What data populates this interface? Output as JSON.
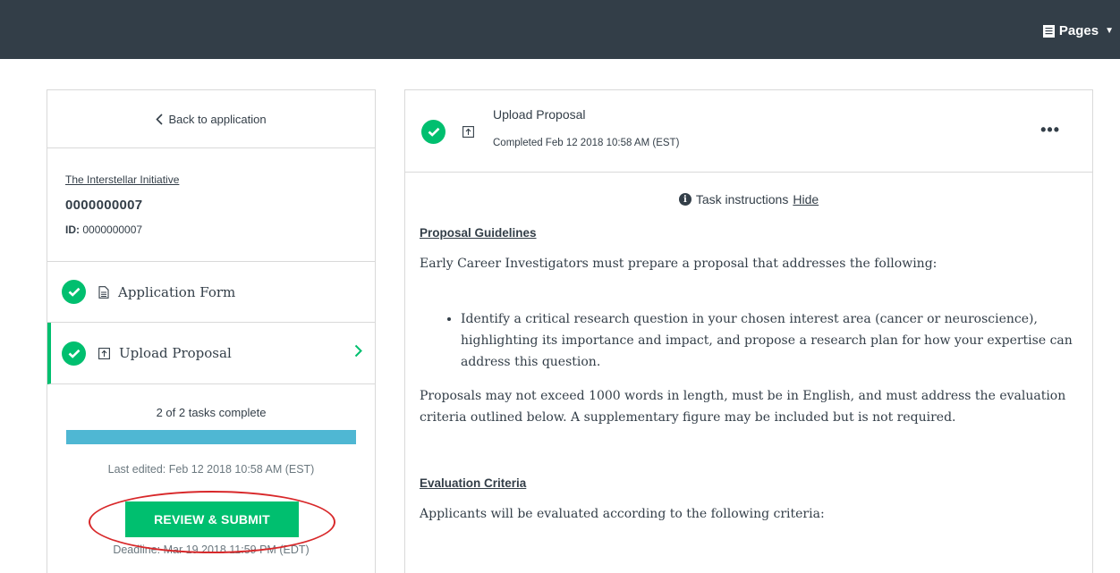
{
  "topbar": {
    "pages_label": "Pages"
  },
  "sidebar": {
    "back_label": "Back to application",
    "program_name": "The Interstellar Initiative",
    "application_number": "0000000007",
    "id_label": "ID:",
    "id_value": "0000000007",
    "tasks": [
      {
        "label": "Application Form",
        "status": "complete"
      },
      {
        "label": "Upload Proposal",
        "status": "complete"
      }
    ],
    "progress_text": "2 of 2 tasks complete",
    "progress_fraction": 1.0,
    "last_edited": "Last edited: Feb 12 2018 10:58 AM (EST)",
    "submit_label": "REVIEW & SUBMIT",
    "deadline": "Deadline: Mar 19 2018 11:59 PM (EDT)"
  },
  "task": {
    "title": "Upload Proposal",
    "completed": "Completed Feb 12 2018 10:58 AM (EST)",
    "more_label": "•••",
    "instructions_label": "Task instructions",
    "hide_label": "Hide",
    "guidelines_heading": "Proposal Guidelines",
    "guidelines_intro": "Early Career Investigators must prepare a proposal that addresses the following:",
    "bullet_1": "Identify a critical research question in your chosen interest area (cancer or neuroscience), highlighting its importance and impact, and propose a research plan for how your expertise can address this question.",
    "proposal_limits": "Proposals may not exceed 1000 words in length, must be in English, and must address the evaluation criteria outlined below. A supplementary figure may be included but is not required.",
    "criteria_heading": "Evaluation Criteria",
    "criteria_intro": "Applicants will be evaluated according to the following criteria:"
  },
  "colors": {
    "accent_green": "#00bf6f",
    "progress_blue": "#4fb7d3",
    "topbar": "#333e48",
    "annotation_red": "#d8282a"
  }
}
